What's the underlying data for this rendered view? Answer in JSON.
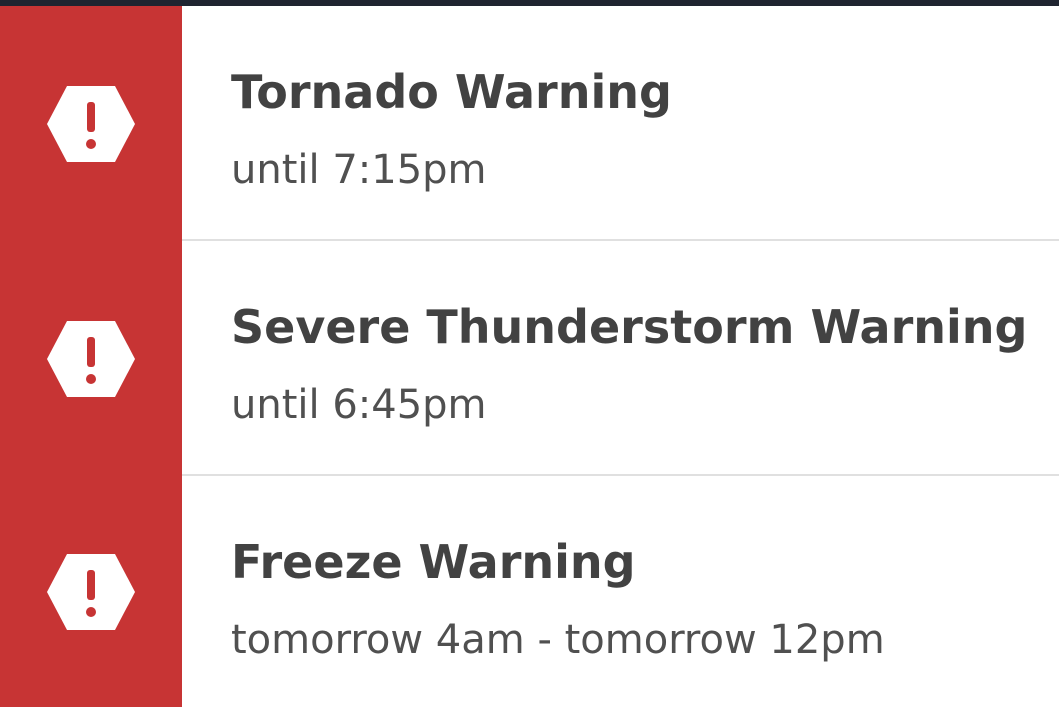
{
  "colors": {
    "badge_background": "#c73434",
    "icon_fill": "#ffffff",
    "title_text": "#424242",
    "time_text": "#505050",
    "divider": "#e0e0e0"
  },
  "alerts": [
    {
      "icon": "warning-hexagon-icon",
      "title": "Tornado Warning",
      "time": "until 7:15pm"
    },
    {
      "icon": "warning-hexagon-icon",
      "title": "Severe Thunderstorm Warning",
      "time": "until 6:45pm"
    },
    {
      "icon": "warning-hexagon-icon",
      "title": "Freeze Warning",
      "time": "tomorrow 4am - tomorrow 12pm"
    }
  ]
}
